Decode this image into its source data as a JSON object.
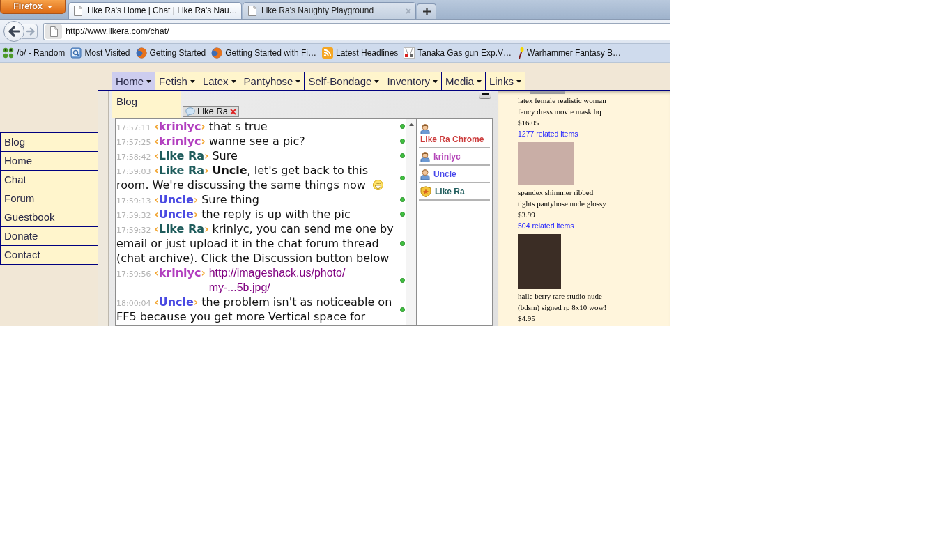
{
  "browser": {
    "menu_button": "Firefox",
    "tabs": [
      {
        "title": "Like Ra's Home | Chat | Like Ra's Nau…",
        "selected": true
      },
      {
        "title": "Like Ra's Naughty Playground",
        "selected": false
      }
    ],
    "address": "http://www.likera.com/chat/",
    "bookmarks": [
      {
        "label": "/b/ - Random",
        "kind": "clover"
      },
      {
        "label": "Most Visited",
        "kind": "magnifier"
      },
      {
        "label": "Getting Started",
        "kind": "globe"
      },
      {
        "label": "Getting Started with Fi…",
        "kind": "globe"
      },
      {
        "label": "Latest Headlines",
        "kind": "feed"
      },
      {
        "label": "Tanaka Gas gun Exp.V…",
        "kind": "tile"
      },
      {
        "label": "Warhammer Fantasy B…",
        "kind": "torch"
      }
    ]
  },
  "page": {
    "top_menu": [
      {
        "label": "Home",
        "selected": true
      },
      {
        "label": "Fetish",
        "selected": false
      },
      {
        "label": "Latex",
        "selected": false
      },
      {
        "label": "Pantyhose",
        "selected": false
      },
      {
        "label": "Self-Bondage",
        "selected": false
      },
      {
        "label": "Inventory",
        "selected": false
      },
      {
        "label": "Media",
        "selected": false
      },
      {
        "label": "Links",
        "selected": false
      }
    ],
    "dropdown": [
      "Blog"
    ],
    "sidebar": [
      "Blog",
      "Home",
      "Chat",
      "Forum",
      "Guestbook",
      "Donate",
      "Contact"
    ],
    "chat": {
      "room": "Like Ra",
      "messages": [
        {
          "time": "17:57:11",
          "open": "‹",
          "author": "krinlyc",
          "close": "›",
          "color": "#b23fbf",
          "kind": "text",
          "text": "that s true",
          "smiley": false
        },
        {
          "time": "17:57:25",
          "open": "‹",
          "author": "krinlyc",
          "close": "›",
          "color": "#b23fbf",
          "kind": "text",
          "text": "wanne see a pic?",
          "smiley": false
        },
        {
          "time": "17:58:42",
          "open": "‹",
          "author": "Like Ra",
          "close": "›",
          "color": "#1f5c5c",
          "kind": "text",
          "text": "Sure",
          "smiley": false
        },
        {
          "time": "17:59:03",
          "open": "‹",
          "author": "Like Ra",
          "close": "›",
          "color": "#1f5c5c",
          "kind": "text",
          "text": "**Uncle**, let's get back to this room. We're discussing the same things now",
          "smiley": true
        },
        {
          "time": "17:59:13",
          "open": "‹",
          "author": "Uncle",
          "close": "›",
          "color": "#4a4ae2",
          "kind": "text",
          "text": "Sure thing",
          "smiley": false
        },
        {
          "time": "17:59:32",
          "open": "‹",
          "author": "Uncle",
          "close": "›",
          "color": "#4a4ae2",
          "kind": "text",
          "text": "the reply is up with the pic",
          "smiley": false
        },
        {
          "time": "17:59:32",
          "open": "‹",
          "author": "Like Ra",
          "close": "›",
          "color": "#1f5c5c",
          "kind": "text",
          "text": "krinlyc, you can send me one by email or just upload it in the chat forum thread (chat archive). Click the Discussion button below",
          "smiley": false
        },
        {
          "time": "17:59:56",
          "open": "‹",
          "author": "krinlyc",
          "close": "›",
          "color": "#b23fbf",
          "kind": "link",
          "text": "http://imageshack.us/photo/my-...5b.jpg/",
          "smiley": false
        },
        {
          "time": "18:00:04",
          "open": "‹",
          "author": "Uncle",
          "close": "›",
          "color": "#4a4ae2",
          "kind": "text",
          "text": "the problem isn't as noticeable on FF5 because you get more Vertical space for",
          "smiley": false
        }
      ],
      "users": [
        {
          "name": "Like Ra Chrome",
          "color": "#cc3b3b",
          "kind": "user"
        },
        {
          "name": "krinlyc",
          "color": "#b445b8",
          "kind": "user"
        },
        {
          "name": "Uncle",
          "color": "#4646ea",
          "kind": "user"
        },
        {
          "name": "Like Ra",
          "color": "#1f5c5c",
          "kind": "admin"
        }
      ]
    },
    "listings": [
      {
        "kind": "cropped",
        "title": "latex female realistic woman fancy dress movie mask hq",
        "price": "$16.05",
        "related": "1277 related items"
      },
      {
        "kind": "landscape",
        "title": "spandex shimmer ribbed tights pantyhose nude glossy",
        "price": "$3.99",
        "related": "504 related items"
      },
      {
        "kind": "portrait",
        "title": "halle berry rare studio nude (bdsm) signed rp 8x10 wow!",
        "price": "$4.95"
      }
    ]
  }
}
